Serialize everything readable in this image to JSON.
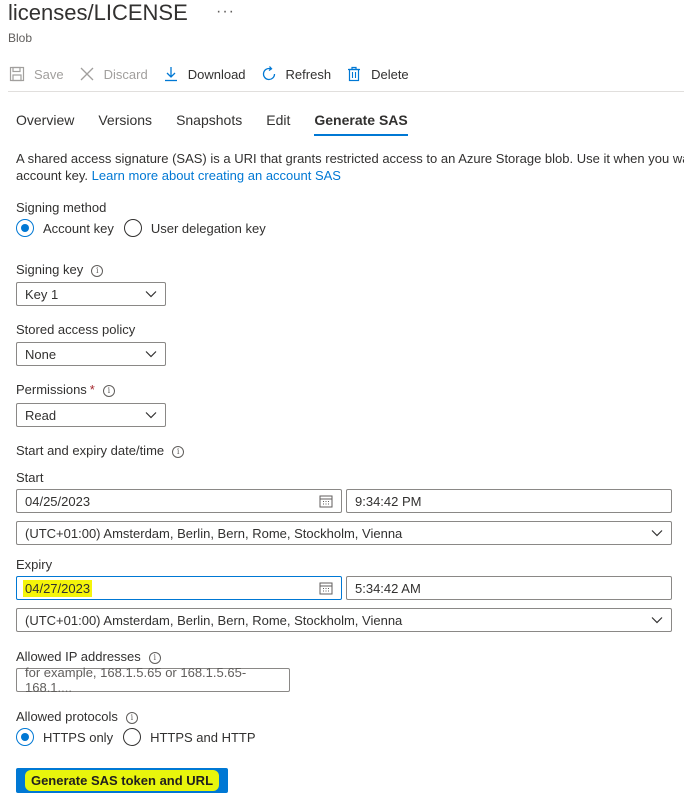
{
  "header": {
    "title": "licenses/LICENSE",
    "more": "···",
    "subtitle": "Blob"
  },
  "toolbar": {
    "save": "Save",
    "discard": "Discard",
    "download": "Download",
    "refresh": "Refresh",
    "delete": "Delete"
  },
  "tabs": [
    "Overview",
    "Versions",
    "Snapshots",
    "Edit",
    "Generate SAS"
  ],
  "description": {
    "line1": "A shared access signature (SAS) is a URI that grants restricted access to an Azure Storage blob. Use it when you want",
    "line2_prefix": "account key.",
    "link": "Learn more about creating an account SAS"
  },
  "signing_method": {
    "label": "Signing method",
    "options": [
      "Account key",
      "User delegation key"
    ],
    "selected": "Account key"
  },
  "signing_key": {
    "label": "Signing key",
    "value": "Key 1"
  },
  "stored_policy": {
    "label": "Stored access policy",
    "value": "None"
  },
  "permissions": {
    "label": "Permissions",
    "required": "*",
    "value": "Read"
  },
  "datetime": {
    "label": "Start and expiry date/time",
    "start_label": "Start",
    "start_date": "04/25/2023",
    "start_time": "9:34:42 PM",
    "start_tz": "(UTC+01:00) Amsterdam, Berlin, Bern, Rome, Stockholm, Vienna",
    "expiry_label": "Expiry",
    "expiry_date": "04/27/2023",
    "expiry_time": "5:34:42 AM",
    "expiry_tz": "(UTC+01:00) Amsterdam, Berlin, Bern, Rome, Stockholm, Vienna"
  },
  "allowed_ip": {
    "label": "Allowed IP addresses",
    "placeholder": "for example, 168.1.5.65 or 168.1.5.65-168.1...."
  },
  "protocols": {
    "label": "Allowed protocols",
    "options": [
      "HTTPS only",
      "HTTPS and HTTP"
    ],
    "selected": "HTTPS only"
  },
  "generate_button": "Generate SAS token and URL",
  "colors": {
    "accent": "#0078d4",
    "highlight": "#f5f50a",
    "text": "#323130"
  }
}
